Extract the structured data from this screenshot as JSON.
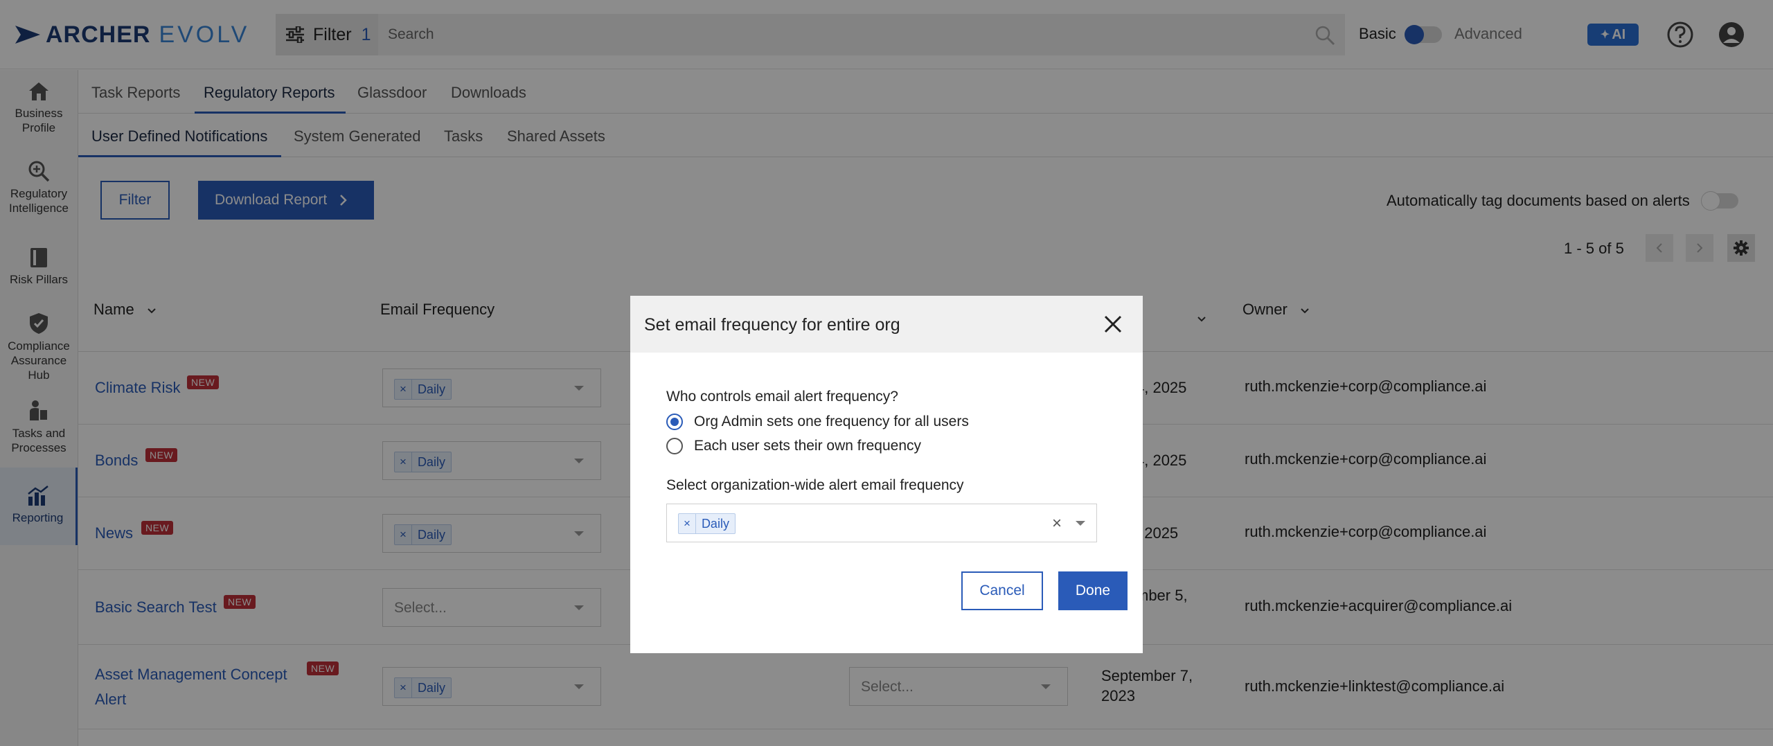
{
  "brand": {
    "archer": "ARCHER",
    "evolv": "EVOLV"
  },
  "topbar": {
    "filter_label": "Filter",
    "filter_count": "1",
    "search_placeholder": "Search",
    "mode_basic": "Basic",
    "mode_advanced": "Advanced",
    "ai_label": "AI"
  },
  "sidebar": {
    "items": [
      {
        "label_lines": [
          "Business",
          "Profile"
        ],
        "icon": "house-icon"
      },
      {
        "label_lines": [
          "Regulatory",
          "Intelligence"
        ],
        "icon": "magnifier-plus-icon"
      },
      {
        "label_lines": [
          "Risk Pillars"
        ],
        "icon": "book-icon"
      },
      {
        "label_lines": [
          "Compliance",
          "Assurance",
          "Hub"
        ],
        "icon": "shield-check-icon"
      },
      {
        "label_lines": [
          "Tasks and",
          "Processes"
        ],
        "icon": "person-clipboard-icon"
      },
      {
        "label_lines": [
          "Reporting"
        ],
        "icon": "chart-icon",
        "active": true
      }
    ]
  },
  "tabs_primary": [
    "Task Reports",
    "Regulatory Reports",
    "Glassdoor",
    "Downloads"
  ],
  "tabs_primary_active": "Regulatory Reports",
  "tabs_secondary": [
    "User Defined Notifications",
    "System Generated",
    "Tasks",
    "Shared Assets"
  ],
  "tabs_secondary_active": "User Defined Notifications",
  "toolbar": {
    "filter_label": "Filter",
    "download_label": "Download Report",
    "autotag_label": "Automatically tag documents based on alerts",
    "autotag_on": false,
    "pagination": "1 - 5 of 5"
  },
  "table": {
    "headers": {
      "name": "Name",
      "email_frequency": "Email Frequency",
      "date_partial": "ed",
      "owner": "Owner"
    },
    "new_badge": "NEW",
    "select_placeholder": "Select...",
    "rows": [
      {
        "name_lines": [
          "Climate Risk"
        ],
        "frequency": "Daily",
        "date_lines": [
          "4, 2025"
        ],
        "owner": "ruth.mckenzie+corp@compliance.ai"
      },
      {
        "name_lines": [
          "Bonds"
        ],
        "frequency": "Daily",
        "date_lines": [
          "4, 2025"
        ],
        "owner": "ruth.mckenzie+corp@compliance.ai"
      },
      {
        "name_lines": [
          "News"
        ],
        "frequency": "Daily",
        "date_lines": [
          ", 2025"
        ],
        "owner": "ruth.mckenzie+corp@compliance.ai"
      },
      {
        "name_lines": [
          "Basic Search Test"
        ],
        "frequency": "",
        "date_lines": [
          "mber 5,"
        ],
        "owner": "ruth.mckenzie+acquirer@compliance.ai"
      },
      {
        "name_lines": [
          "Asset Management Concept",
          "Alert"
        ],
        "frequency": "Daily",
        "date_lines": [
          "September 7,",
          "2023"
        ],
        "owner": "ruth.mckenzie+linktest@compliance.ai",
        "extra_select": "Select..."
      }
    ]
  },
  "modal": {
    "title": "Set email frequency for entire org",
    "question": "Who controls email alert frequency?",
    "options": [
      {
        "label": "Org Admin sets one frequency for all users",
        "checked": true
      },
      {
        "label": "Each user sets their own frequency",
        "checked": false
      }
    ],
    "frequency_label": "Select organization-wide alert email frequency",
    "selected_frequency": "Daily",
    "cancel_label": "Cancel",
    "done_label": "Done"
  },
  "colors": {
    "primary": "#2a5bb8",
    "brand_dark": "#1d3b75",
    "brand_light": "#3a86d8",
    "badge_red": "#c0303a"
  }
}
